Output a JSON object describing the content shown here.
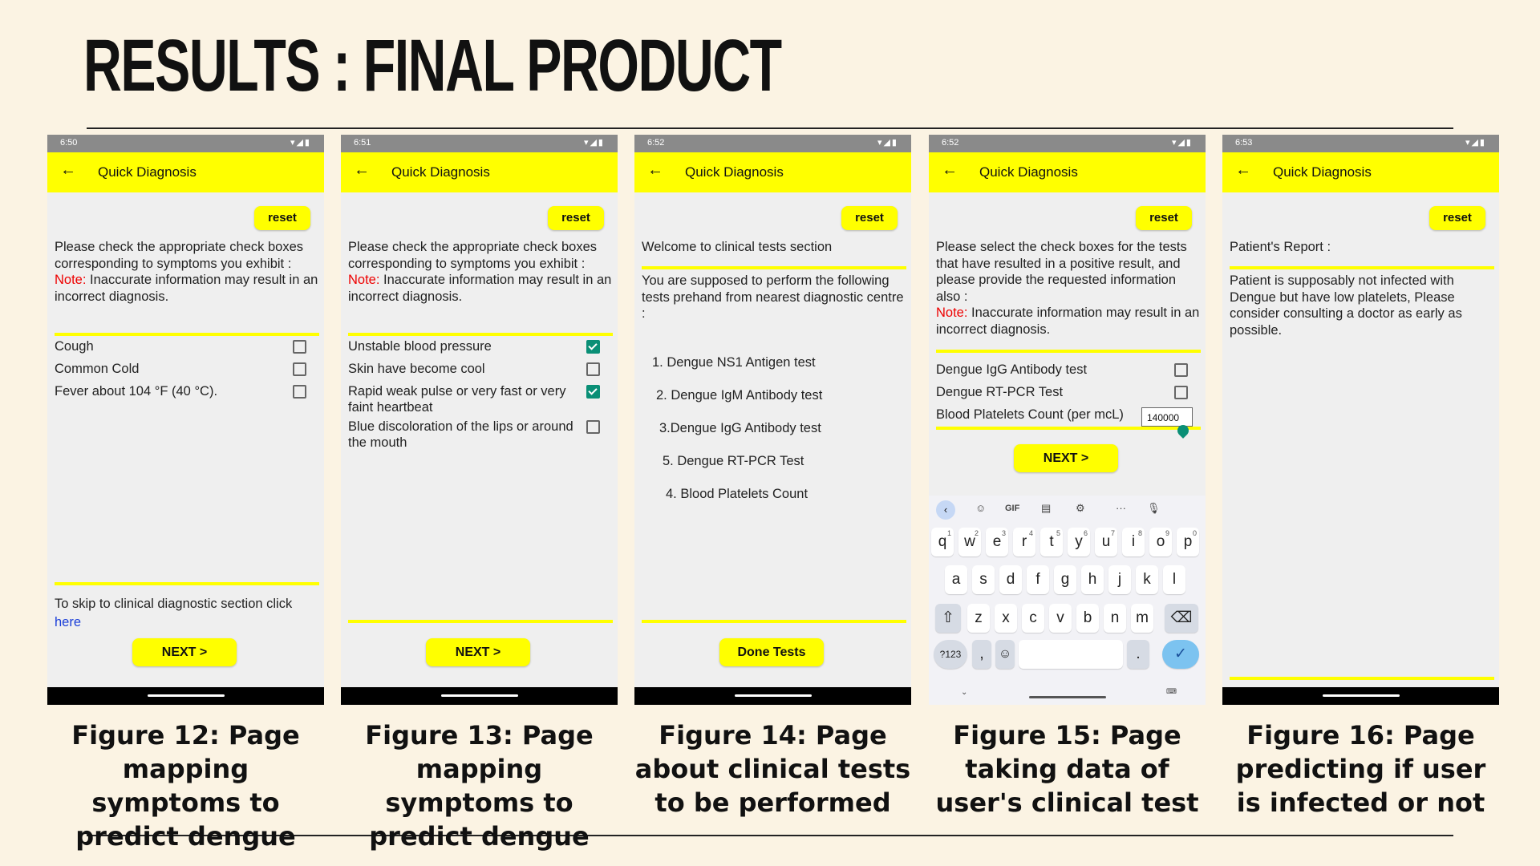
{
  "slide": {
    "title": "RESULTS : FINAL PRODUCT"
  },
  "common": {
    "app_title": "Quick Diagnosis",
    "reset_label": "reset",
    "note_prefix": "Note:",
    "note_text": " Inaccurate information may result in an incorrect diagnosis."
  },
  "phones": [
    {
      "time": "6:50",
      "intro": "Please check the appropriate check boxes corresponding to symptoms you exhibit :",
      "items": [
        {
          "label": "Cough",
          "checked": false
        },
        {
          "label": "Common Cold",
          "checked": false
        },
        {
          "label": "Fever about 104 °F (40 °C).",
          "checked": false
        }
      ],
      "skip_text": "To skip to clinical diagnostic section click",
      "skip_link": "here",
      "button": "NEXT >",
      "caption": "Figure 12: Page mapping symptoms to predict dengue"
    },
    {
      "time": "6:51",
      "intro": "Please check the appropriate check boxes corresponding to symptoms you exhibit :",
      "items": [
        {
          "label": "Unstable blood pressure",
          "checked": true
        },
        {
          "label": "Skin have become cool",
          "checked": false
        },
        {
          "label": "Rapid weak pulse or very fast or very faint heartbeat",
          "checked": true
        },
        {
          "label": "Blue discoloration of the lips or around the mouth",
          "checked": false
        }
      ],
      "button": "NEXT >",
      "caption": "Figure 13:  Page mapping symptoms to predict dengue"
    },
    {
      "time": "6:52",
      "welcome": "Welcome to clinical tests section",
      "intro": "You are supposed to perform the following tests prehand from nearest diagnostic centre :",
      "tests": [
        "1. Dengue NS1 Antigen test",
        "2. Dengue IgM Antibody test",
        "3.Dengue IgG Antibody test",
        "5. Dengue RT-PCR Test",
        "4. Blood Platelets Count"
      ],
      "button": "Done Tests",
      "caption": "Figure 14: Page about clinical tests to be performed"
    },
    {
      "time": "6:52",
      "intro": "Please select the check boxes for the tests that have resulted in a positive result, and please provide the requested information also :",
      "items": [
        {
          "label": "Dengue IgG Antibody test",
          "checked": false
        },
        {
          "label": "Dengue RT-PCR Test",
          "checked": false
        }
      ],
      "platelets_label": "Blood Platelets Count (per mcL)",
      "platelets_value": "140000",
      "button": "NEXT >",
      "keyboard": {
        "toolbar": [
          "GIF",
          "···"
        ],
        "row1": [
          "q",
          "w",
          "e",
          "r",
          "t",
          "y",
          "u",
          "i",
          "o",
          "p"
        ],
        "row1_nums": [
          "1",
          "2",
          "3",
          "4",
          "5",
          "6",
          "7",
          "8",
          "9",
          "0"
        ],
        "row2": [
          "a",
          "s",
          "d",
          "f",
          "g",
          "h",
          "j",
          "k",
          "l"
        ],
        "row3": [
          "z",
          "x",
          "c",
          "v",
          "b",
          "n",
          "m"
        ],
        "sym_key": "?123",
        "comma": ",",
        "period": "."
      },
      "caption": "Figure 15: Page taking data of user's clinical test"
    },
    {
      "time": "6:53",
      "report_title": "Patient's Report :",
      "report_text": "Patient is supposably not infected with Dengue but have low platelets, Please consider consulting a doctor as early as possible.",
      "caption": "Figure 16: Page predicting if user is infected or not"
    }
  ]
}
